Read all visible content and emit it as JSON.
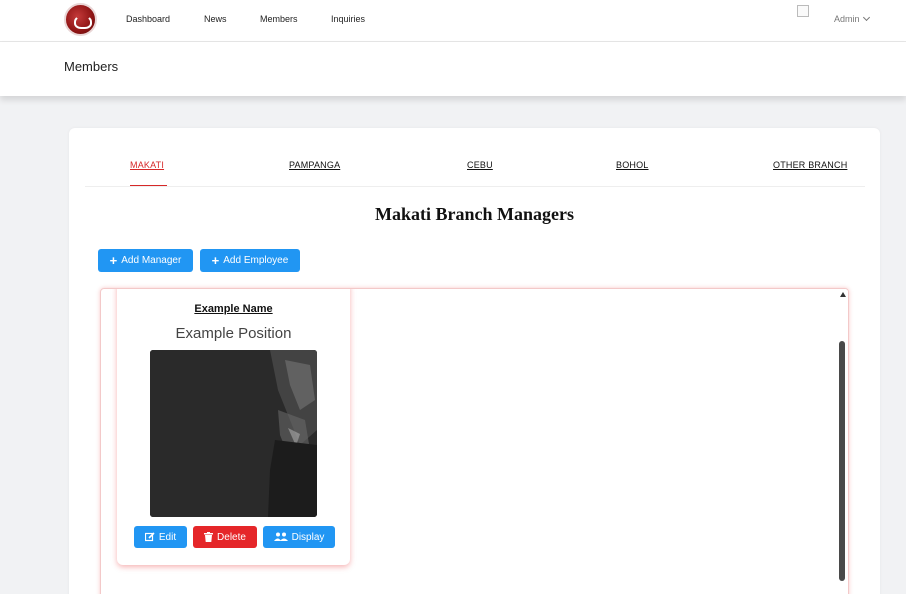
{
  "nav": {
    "links": [
      "Dashboard",
      "News",
      "Members",
      "Inquiries"
    ],
    "user": "Admin"
  },
  "header": {
    "title": "Members"
  },
  "tabs": [
    "MAKATI",
    "PAMPANGA",
    "CEBU",
    "BOHOL",
    "OTHER BRANCH"
  ],
  "main": {
    "title": "Makati Branch Managers",
    "add_manager": "Add Manager",
    "add_employee": "Add Employee"
  },
  "member": {
    "name": "Example Name",
    "position": "Example Position",
    "edit": "Edit",
    "delete": "Delete",
    "display": "Display"
  },
  "colors": {
    "accent_blue": "#2196f3",
    "danger_red": "#e52629",
    "active_tab": "#d62828"
  },
  "icons": [
    "plus-icon",
    "edit-icon",
    "trash-icon",
    "users-icon",
    "chevron-down-icon"
  ]
}
